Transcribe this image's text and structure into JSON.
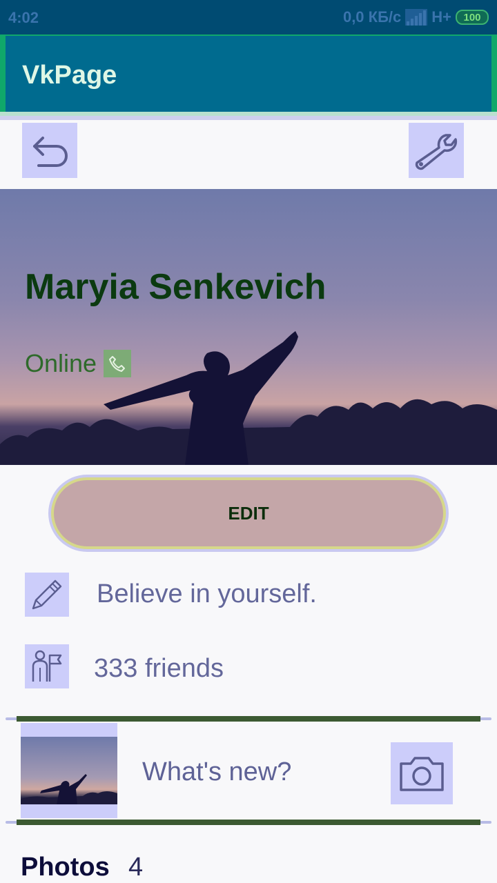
{
  "status_bar": {
    "time": "4:02",
    "network_speed": "0,0 КБ/с",
    "network_type": "H+",
    "battery": "100"
  },
  "app_bar": {
    "title": "VkPage"
  },
  "toolbar": {
    "back_icon": "back-arrow-icon",
    "settings_icon": "wrench-icon"
  },
  "profile": {
    "name": "Maryia Senkevich",
    "status": "Online",
    "status_icon": "phone-icon"
  },
  "edit_button": {
    "label": "EDIT"
  },
  "info": {
    "status_text": "Believe in yourself.",
    "status_icon": "pencil-icon",
    "friends_text": "333 friends",
    "friends_icon": "friends-icon"
  },
  "post": {
    "placeholder": "What's new?",
    "camera_icon": "camera-icon"
  },
  "photos": {
    "label": "Photos",
    "count": "4"
  },
  "colors": {
    "status_bar": "#004b72",
    "app_bar": "#006b8f",
    "edit_button": "#c4a6a8",
    "icon_bg": "#cccdfa",
    "divider": "#3c5a32"
  }
}
